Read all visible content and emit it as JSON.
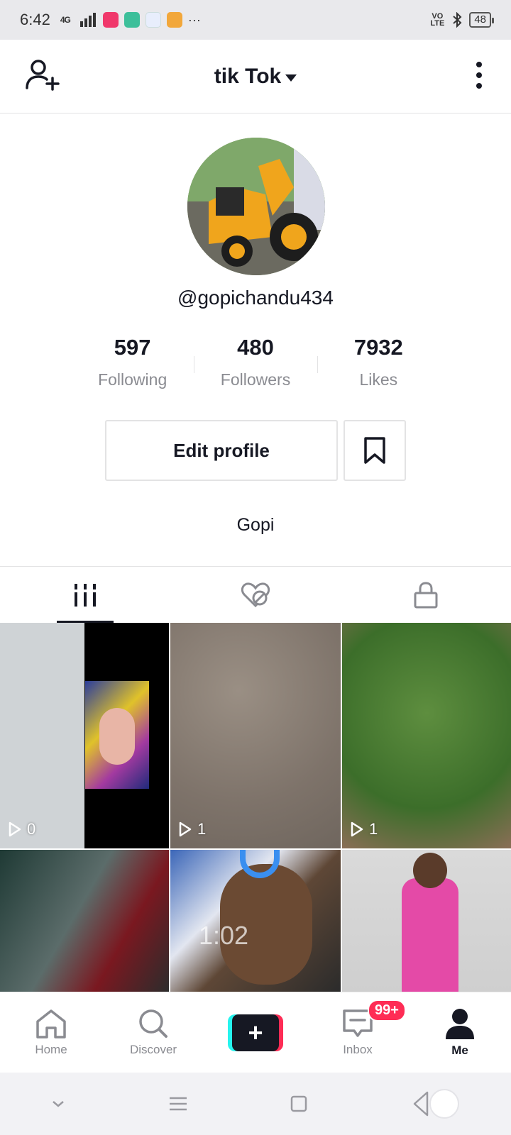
{
  "status_bar": {
    "time": "6:42",
    "signal": "4G",
    "more": "···",
    "volte": "VO LTE",
    "battery": "48"
  },
  "header": {
    "title": "tik Tok"
  },
  "profile": {
    "username": "@gopichandu434",
    "bio": "Gopi",
    "edit_label": "Edit profile"
  },
  "stats": [
    {
      "value": "597",
      "label": "Following"
    },
    {
      "value": "480",
      "label": "Followers"
    },
    {
      "value": "7932",
      "label": "Likes"
    }
  ],
  "videos": [
    {
      "views": "0"
    },
    {
      "views": "1"
    },
    {
      "views": "1"
    },
    {
      "views": ""
    },
    {
      "views": "",
      "overlay_text": "1:02"
    },
    {
      "views": ""
    }
  ],
  "bottom_nav": {
    "home": "Home",
    "discover": "Discover",
    "inbox": "Inbox",
    "inbox_badge": "99+",
    "me": "Me"
  },
  "colors": {
    "accent": "#fe2c55",
    "cyan": "#25f4ee",
    "text": "#161823",
    "muted": "#8a8b91"
  }
}
